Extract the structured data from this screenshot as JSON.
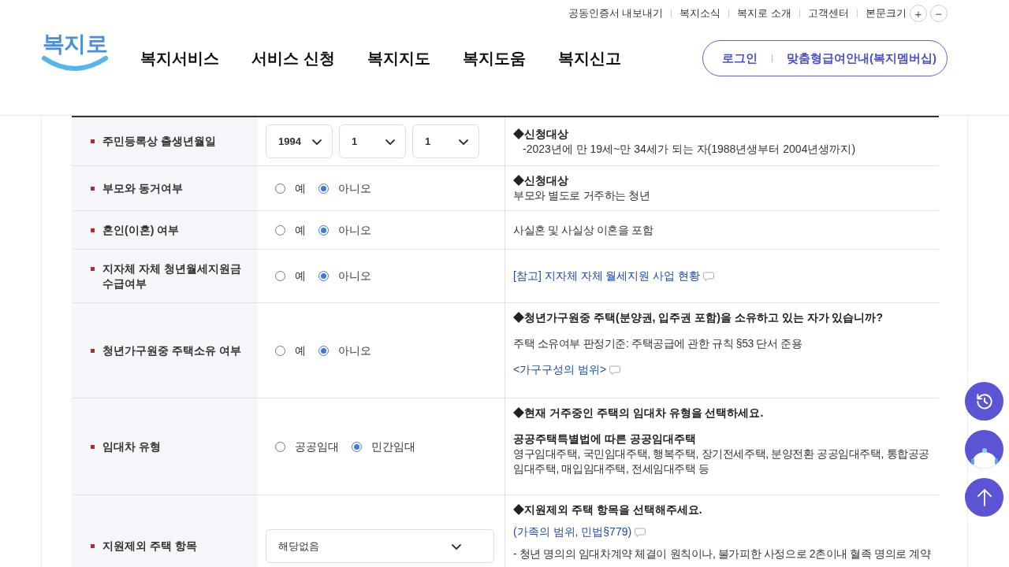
{
  "utility_links": [
    "공동인증서 내보내기",
    "복지소식",
    "복지로 소개",
    "고객센터"
  ],
  "font_size": {
    "label": "본문크기",
    "increase": "+",
    "decrease": "−"
  },
  "logo": {
    "text": "복지로"
  },
  "nav": [
    "복지서비스",
    "서비스 신청",
    "복지지도",
    "복지도움",
    "복지신고"
  ],
  "account": {
    "login": "로그인",
    "membership": "맞춤형급여안내(복지멤버십)"
  },
  "rows": [
    {
      "label": "주민등록상 출생년월일",
      "control": {
        "kind": "selects",
        "values": [
          "1994",
          "1",
          "1"
        ]
      },
      "paragraphs": [
        [
          {
            "kind": "heading",
            "text": "◆신청대상"
          },
          {
            "kind": "indent",
            "text": "-2023년에 만 19세~만 34세가 되는 자(1988년생부터 2004년생까지)"
          }
        ]
      ]
    },
    {
      "label": "부모와 동거여부",
      "control": {
        "kind": "radio",
        "options": [
          {
            "label": "예",
            "selected": false
          },
          {
            "label": "아니오",
            "selected": true
          }
        ]
      },
      "paragraphs": [
        [
          {
            "kind": "heading",
            "text": "◆신청대상"
          },
          {
            "kind": "text",
            "text": "부모와 별도로 거주하는 청년"
          }
        ]
      ]
    },
    {
      "label": "혼인(이혼) 여부",
      "control": {
        "kind": "radio",
        "options": [
          {
            "label": "예",
            "selected": false
          },
          {
            "label": "아니오",
            "selected": true
          }
        ]
      },
      "paragraphs": [
        [
          {
            "kind": "text",
            "text": "사실혼 및 사실상 이혼을 포함"
          }
        ]
      ]
    },
    {
      "label": "지자체 자체 청년월세지원금 수급여부",
      "control": {
        "kind": "radio",
        "options": [
          {
            "label": "예",
            "selected": false
          },
          {
            "label": "아니오",
            "selected": true
          }
        ]
      },
      "paragraphs": [
        [
          {
            "kind": "link",
            "text": "[참고] 지자체 자체 월세지원 사업 현황"
          }
        ]
      ]
    },
    {
      "label": "청년가구원중 주택소유 여부",
      "control": {
        "kind": "radio",
        "options": [
          {
            "label": "예",
            "selected": false
          },
          {
            "label": "아니오",
            "selected": true
          }
        ]
      },
      "paragraphs": [
        [
          {
            "kind": "heading",
            "text": "◆청년가구원중 주택(분양권, 입주권 포함)을 소유하고 있는 자가 있습니까?"
          }
        ],
        [
          {
            "kind": "text",
            "text": "주택 소유여부 판정기준: 주택공급에 관한 규칙 §53 단서 준용"
          }
        ],
        [
          {
            "kind": "link",
            "text": "<가구구성의 범위>"
          }
        ]
      ]
    },
    {
      "label": "임대차 유형",
      "control": {
        "kind": "radio",
        "options": [
          {
            "label": "공공임대",
            "selected": false
          },
          {
            "label": "민간임대",
            "selected": true
          }
        ]
      },
      "paragraphs": [
        [
          {
            "kind": "heading",
            "text": "◆현재 거주중인 주택의 임대차 유형을 선택하세요."
          }
        ],
        [
          {
            "kind": "heading",
            "text": "공공주택특별법에 따른 공공임대주택"
          },
          {
            "kind": "text",
            "text": "영구임대주택, 국민임대주택, 행복주택, 장기전세주택, 분양전환 공공임대주택, 통합공공임대주택, 매입임대주택, 전세임대주택 등"
          }
        ]
      ]
    },
    {
      "label": "지원제외 주택 항목",
      "control": {
        "kind": "select",
        "value": "해당없음"
      },
      "paragraphs": [
        [
          {
            "kind": "heading",
            "text": "◆지원제외 주택 항목을 선택해주세요."
          }
        ],
        [
          {
            "kind": "link",
            "text": "(가족의 범위, 민법§779)"
          }
        ],
        [
          {
            "kind": "text",
            "text": "- 청년 명의의 임대차계약 체결이 원칙이나, 불가피한 사정으로 2촌이내 혈족 명의로 계약"
          }
        ]
      ]
    }
  ]
}
